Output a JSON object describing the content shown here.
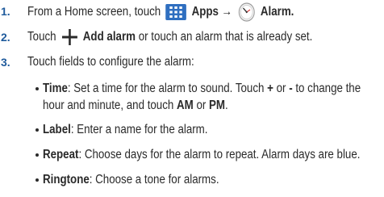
{
  "steps": [
    {
      "num": "1.",
      "pre": "From a Home screen, touch",
      "apps": "Apps",
      "arrow": "→",
      "alarm": "Alarm."
    },
    {
      "num": "2.",
      "pre": "Touch",
      "add": "Add alarm",
      "post": "or touch an alarm that is already set."
    },
    {
      "num": "3.",
      "text": "Touch fields to configure the alarm:"
    }
  ],
  "bullets": {
    "time": {
      "term": "Time",
      "a": ": Set a time for the alarm to sound. Touch",
      "plus": "+",
      "or1": "or",
      "minus": "-",
      "b": "to change the",
      "line2a": "hour and minute, and touch",
      "am": "AM",
      "or2": "or",
      "pm": "PM",
      "end": "."
    },
    "label": {
      "term": "Label",
      "text": ": Enter a name for the alarm."
    },
    "repeat": {
      "term": "Repeat",
      "text": ": Choose days for the alarm to repeat. Alarm days are blue."
    },
    "ringtone": {
      "term": "Ringtone",
      "text": ": Choose a tone for alarms."
    }
  },
  "colors": {
    "step_number": "#1e5a9c",
    "text": "#2a2a2a",
    "apps_icon": "#2f6fc0"
  },
  "icons": [
    "apps-grid-icon",
    "clock-icon",
    "plus-icon"
  ]
}
